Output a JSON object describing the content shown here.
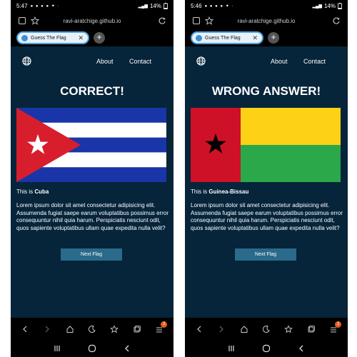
{
  "phones": [
    {
      "status": {
        "time": "5:47",
        "battery": "14%"
      },
      "browser": {
        "url": "ravi-aratchige.github.io",
        "tab_label": "Guess The Flag"
      },
      "nav": {
        "about": "About",
        "contact": "Contact"
      },
      "heading": "CORRECT!",
      "flag": "cuba-flag",
      "answer_prefix": "This is ",
      "country": "Cuba",
      "paragraph": "Lorem ipsum dolor sit amet consectetur adipisicing elit. Assumenda fugiat saepe earum voluptatibus possimus error consequuntur nihil quia harum. Perspiciatis nesciunt odit, quos sapiente voluptatibus ullam quae expedita nulla velit?",
      "button": "Next Flag",
      "tabs_badge": "2"
    },
    {
      "status": {
        "time": "5:46",
        "battery": "14%"
      },
      "browser": {
        "url": "ravi-aratchige.github.io",
        "tab_label": "Guess The Flag"
      },
      "nav": {
        "about": "About",
        "contact": "Contact"
      },
      "heading": "WRONG ANSWER!",
      "flag": "guinea-bissau-flag",
      "answer_prefix": "This is ",
      "country": "Guinea-Bissau",
      "paragraph": "Lorem ipsum dolor sit amet consectetur adipisicing elit. Assumenda fugiat saepe earum voluptatibus possimus error consequuntur nihil quia harum. Perspiciatis nesciunt odit, quos sapiente voluptatibus ullam quae expedita nulla velit?",
      "button": "Next Flag",
      "tabs_badge": "2"
    }
  ],
  "colors": {
    "page_background": "#06243a",
    "button": "#2a6a8b",
    "tab_border": "#4aa3e0",
    "badge": "#e85d1a"
  }
}
